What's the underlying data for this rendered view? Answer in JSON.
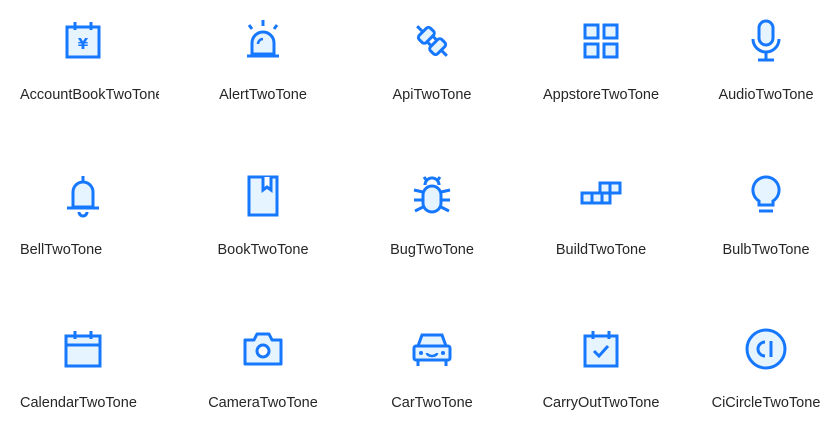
{
  "accent_color": "#1677ff",
  "fill_color": "#e6f4ff",
  "text_color": "#262626",
  "icons": [
    {
      "label": "AccountBookTwoTone",
      "icon": "account-book-icon"
    },
    {
      "label": "AlertTwoTone",
      "icon": "alert-icon"
    },
    {
      "label": "ApiTwoTone",
      "icon": "api-icon"
    },
    {
      "label": "AppstoreTwoTone",
      "icon": "appstore-icon"
    },
    {
      "label": "AudioTwoTone",
      "icon": "audio-icon"
    },
    {
      "label": "BellTwoTone",
      "icon": "bell-icon"
    },
    {
      "label": "BookTwoTone",
      "icon": "book-icon"
    },
    {
      "label": "BugTwoTone",
      "icon": "bug-icon"
    },
    {
      "label": "BuildTwoTone",
      "icon": "build-icon"
    },
    {
      "label": "BulbTwoTone",
      "icon": "bulb-icon"
    },
    {
      "label": "CalendarTwoTone",
      "icon": "calendar-icon"
    },
    {
      "label": "CameraTwoTone",
      "icon": "camera-icon"
    },
    {
      "label": "CarTwoTone",
      "icon": "car-icon"
    },
    {
      "label": "CarryOutTwoTone",
      "icon": "carry-out-icon"
    },
    {
      "label": "CiCircleTwoTone",
      "icon": "ci-circle-icon"
    }
  ]
}
